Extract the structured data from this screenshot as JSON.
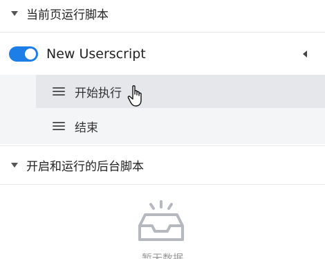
{
  "current_page_scripts": {
    "header_label": "当前页运行脚本",
    "scripts": [
      {
        "name": "New Userscript",
        "enabled": true,
        "menu_items": [
          {
            "label": "开始执行",
            "icon": "menu-lines-icon"
          },
          {
            "label": "结束",
            "icon": "menu-lines-icon"
          }
        ]
      }
    ]
  },
  "background_scripts": {
    "header_label": "开启和运行的后台脚本",
    "empty_icon": "empty-inbox-icon",
    "empty_text": "暂无数据"
  },
  "colors": {
    "toggle_on": "#1e7ee8",
    "menu_bg": "#f4f5f7",
    "menu_hover_bg": "#e6e7ea"
  }
}
